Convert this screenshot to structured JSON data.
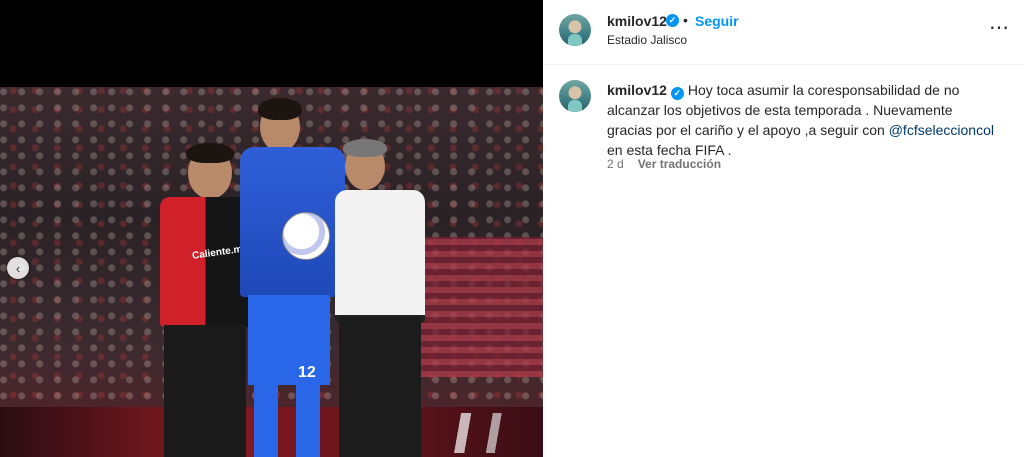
{
  "post": {
    "username": "kmilov12",
    "verified_mark": "✓",
    "separator": "•",
    "follow_label": "Seguir",
    "location": "Estadio Jalisco",
    "more_icon": "⋯"
  },
  "caption": {
    "username": "kmilov12",
    "text_before": " Hoy toca asumir la coresponsabilidad de no alcanzar los objetivos de esta temporada . Nuevamente gracias por el cariño y el apoyo ,a seguir con ",
    "mention": "@fcfseleccioncol",
    "text_after": " en esta fecha FIFA ."
  },
  "meta": {
    "time": "2 d",
    "translate_label": "Ver traducción"
  },
  "media": {
    "prev_icon": "‹",
    "jersey_left_text": "Caliente.mx",
    "jersey_right_number": "12"
  }
}
